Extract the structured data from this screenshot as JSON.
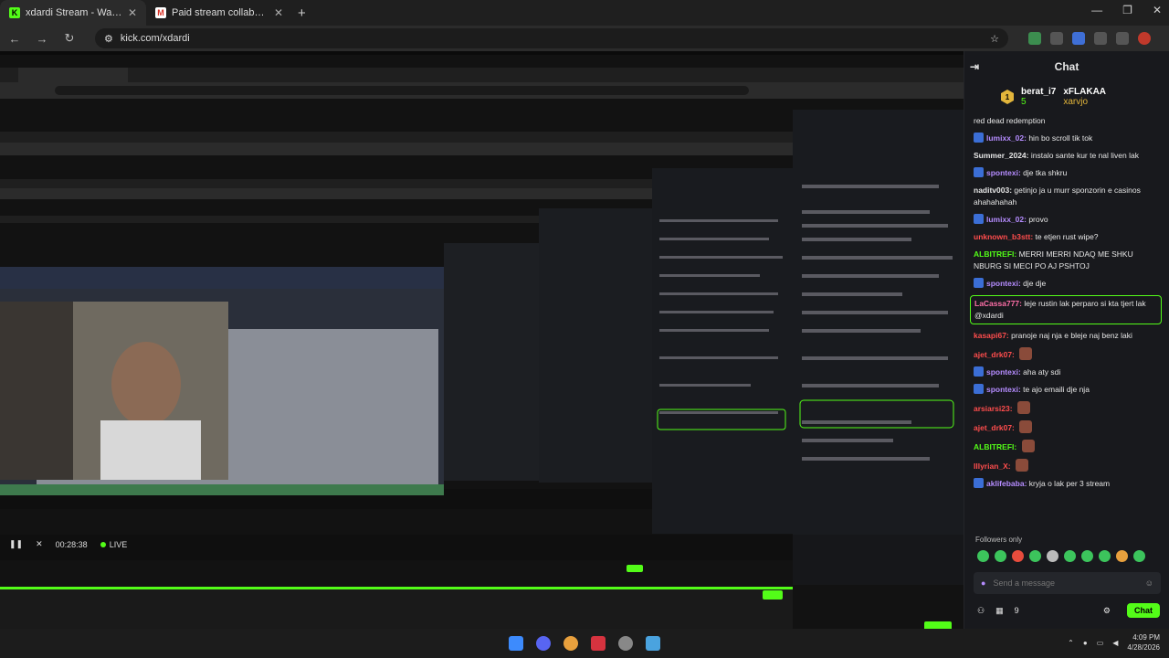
{
  "browser": {
    "tabs": [
      {
        "label": "xdardi Stream - Watch Live on K",
        "icon": "kick-icon",
        "active": true
      },
      {
        "label": "Paid stream collaboration (edu",
        "icon": "gmail-icon",
        "active": false
      }
    ],
    "url": "kick.com/xdardi"
  },
  "player": {
    "time": "00:28:38",
    "live_label": "LIVE"
  },
  "chat": {
    "title": "Chat",
    "pinned": {
      "user1": "berat_i7",
      "user1_sub": "5",
      "user2": "xFLAKAA",
      "user2_badge": "3",
      "user3": "xarvjo",
      "user3_badge": "3"
    },
    "messages": [
      {
        "user": "",
        "text": "red dead redemption",
        "color": "#e6e6e6"
      },
      {
        "user": "lumixx_02:",
        "text": "hin bo scroll tik tok",
        "color": "#b58cff"
      },
      {
        "user": "Summer_2024:",
        "text": "instalo sante kur te nal liven lak",
        "color": "#e6e6e6"
      },
      {
        "user": "spontexi:",
        "text": "dje tka shkru",
        "color": "#b58cff"
      },
      {
        "user": "naditv003:",
        "text": "getinjo ja u murr sponzorin e casinos ahahahahah",
        "color": "#e6e6e6"
      },
      {
        "user": "lumixx_02:",
        "text": "provo",
        "color": "#b58cff"
      },
      {
        "user": "unknown_b3stt:",
        "text": "te etjen rust wipe?",
        "color": "#ff4d4d"
      },
      {
        "user": "ALBITREFI:",
        "text": "MERRI MERRI NDAQ ME SHKU NBURG SI MECI PO AJ PSHTOJ",
        "color": "#53fc18"
      },
      {
        "user": "spontexi:",
        "text": "dje dje",
        "color": "#b58cff"
      },
      {
        "user": "LaCassa777:",
        "text": "leje rustin lak perparo si kta tjert lak @xdardi",
        "color": "#ff6fa8"
      },
      {
        "user": "kasapi67:",
        "text": "pranoje naj nja e bleje naj benz laki",
        "color": "#ff4d4d"
      },
      {
        "user": "ajet_drk07:",
        "text": "",
        "color": "#ff4d4d"
      },
      {
        "user": "spontexi:",
        "text": "aha aty sdi",
        "color": "#b58cff"
      },
      {
        "user": "spontexi:",
        "text": "te ajo emaili dje nja",
        "color": "#b58cff"
      },
      {
        "user": "arsiarsi23:",
        "text": "",
        "color": "#ff4d4d"
      },
      {
        "user": "ajet_drk07:",
        "text": "",
        "color": "#ff4d4d"
      },
      {
        "user": "ALBITREFI:",
        "text": "",
        "color": "#53fc18"
      },
      {
        "user": "Illyrian_X:",
        "text": "",
        "color": "#ff4d4d"
      },
      {
        "user": "aklifebaba:",
        "text": "kryja o lak per 3 stream",
        "color": "#b58cff"
      }
    ],
    "followers_only": "Followers only",
    "send_placeholder": "Send a message",
    "count": "9",
    "chat_button": "Chat"
  },
  "taskbar": {
    "time": "4:09 PM",
    "date": "4/28/2026"
  },
  "colors": {
    "accent": "#53fc18",
    "chat_bg": "#18191d"
  }
}
